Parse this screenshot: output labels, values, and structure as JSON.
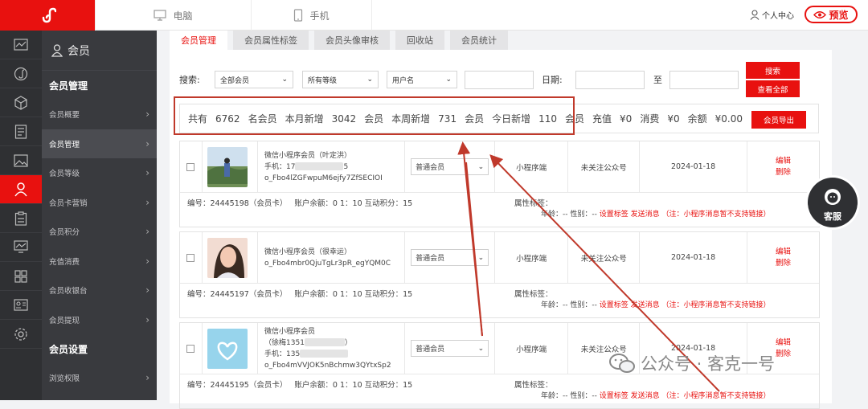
{
  "topbar": {
    "tab_pc": "电脑",
    "tab_mobile": "手机",
    "user_center": "个人中心",
    "preview": "预览",
    "accent": "#e8110f"
  },
  "menu": {
    "title": "会员",
    "group1": "会员管理",
    "items1": [
      "会员概要",
      "会员管理",
      "会员等级",
      "会员卡营销",
      "会员积分",
      "充值消费",
      "会员收银台",
      "会员提现"
    ],
    "group2": "会员设置",
    "items2": [
      "浏览权限"
    ],
    "active": "会员管理"
  },
  "icons": [
    "chart-icon",
    "music-icon",
    "cube-icon",
    "document-icon",
    "image-icon",
    "user-icon",
    "clipboard-icon",
    "monitor-chart-icon",
    "grid-icon",
    "id-card-icon",
    "settings-icon"
  ],
  "tabs": [
    "会员管理",
    "会员属性标签",
    "会员头像审核",
    "回收站",
    "会员统计"
  ],
  "search": {
    "label": "搜索:",
    "select_member": "全部会员",
    "select_level": "所有等级",
    "select_field": "用户名",
    "date_label": "日期:",
    "to_label": "至",
    "btn_search": "搜索",
    "btn_all": "查看全部"
  },
  "stats": {
    "t1": "共有",
    "total": "6762",
    "t2": "名会员",
    "t3": "本月新增",
    "month": "3042",
    "t4": "会员",
    "t5": "本周新增",
    "week": "731",
    "t6": "会员",
    "t7": "今日新增",
    "today": "110",
    "t8": "会员",
    "t9": "充值",
    "recharge": "¥0",
    "t10": "消费",
    "consume": "¥0",
    "t11": "余额",
    "balance": "¥0.00",
    "export": "会员导出"
  },
  "members": [
    {
      "name": "微信小程序会员（叶定洪）",
      "phone": "手机：17",
      "phone_tail": "5",
      "openid": "o_Fbo4lZGFwpuM6ejfy7ZfSECIOI",
      "level": "普通会员",
      "source": "小程序端",
      "follow": "未关注公众号",
      "date": "2024-01-18",
      "edit": "编辑",
      "del": "删除",
      "id_text": "编号：24445198（会员卡）",
      "acc_text": "账户余额：0  1：10  互动积分：15",
      "attr": "属性标签：",
      "age_text": "年龄：--  性别：--",
      "actions": "设置标签 发送消息 （注：小程序消息暂不支持链接）"
    },
    {
      "name": "微信小程序会员（很幸运）",
      "phone": "",
      "phone_tail": "",
      "openid": "o_Fbo4mbr0QjuTgLr3pR_egYQM0C",
      "level": "普通会员",
      "source": "小程序端",
      "follow": "未关注公众号",
      "date": "2024-01-18",
      "edit": "编辑",
      "del": "删除",
      "id_text": "编号：24445197（会员卡）",
      "acc_text": "账户余额：0  1：10  互动积分：15",
      "attr": "属性标签：",
      "age_text": "年龄：--  性别：--",
      "actions": "设置标签 发送消息 （注：小程序消息暂不支持链接）"
    },
    {
      "name": "微信小程序会员",
      "name2": "（徐梅1351",
      "name2_tail": "）",
      "phone": "手机：135",
      "phone_tail": "",
      "openid": "o_Fbo4mVVJOK5nBchmw3QYtxSp2",
      "level": "普通会员",
      "source": "小程序端",
      "follow": "未关注公众号",
      "date": "2024-01-18",
      "edit": "编辑",
      "del": "删除",
      "id_text": "编号：24445195（会员卡）",
      "acc_text": "账户余额：0  1：10  互动积分：15",
      "attr": "属性标签：",
      "age_text": "年龄：--  性别：--",
      "actions": "设置标签 发送消息 （注：小程序消息暂不支持链接）"
    }
  ],
  "service": "客服",
  "watermark": "公众号 · 客克一号"
}
